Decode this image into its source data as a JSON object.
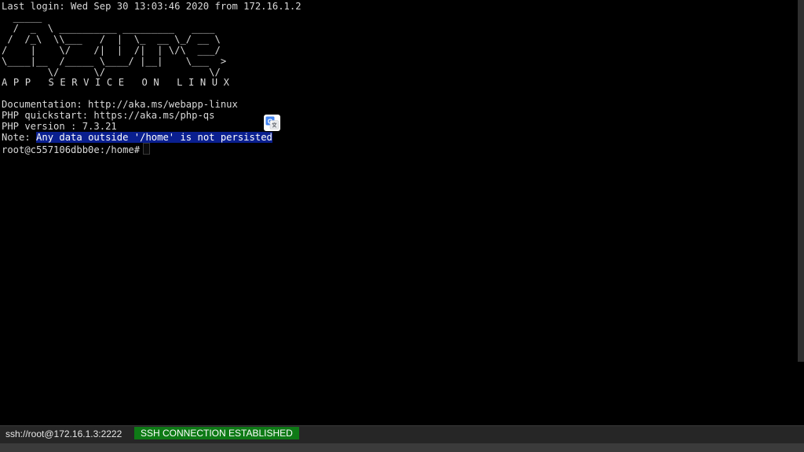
{
  "terminal": {
    "last_login": "Last login: Wed Sep 30 13:03:46 2020 from 172.16.1.2",
    "ascii_art": [
      "  _____",
      "  /  _  \\ __________ _________   ____",
      " /  /_\\  \\\\___   /  |  \\_  __ \\_/ __ \\",
      "/    |    \\/    /|  |  /|  | \\/\\  ___/",
      "\\____|__  /_____ \\____/ |__|    \\___  >",
      "        \\/      \\/                  \\/"
    ],
    "app_service": "A P P   S E R V I C E   O N   L I N U X",
    "documentation": "Documentation: http://aka.ms/webapp-linux",
    "php_quickstart": "PHP quickstart: https://aka.ms/php-qs",
    "php_version": "PHP version : 7.3.21",
    "note_label": "Note: ",
    "note_selected": "Any data outside '/home' is not persisted",
    "prompt": "root@c557106dbb0e:/home#"
  },
  "translate_button": {
    "icon": "google-translate-icon",
    "glyph": "G",
    "accent": "#4285f4"
  },
  "status_bar": {
    "connection": "ssh://root@172.16.1.3:2222",
    "state": "SSH CONNECTION ESTABLISHED",
    "state_color": "#0e7a16"
  }
}
